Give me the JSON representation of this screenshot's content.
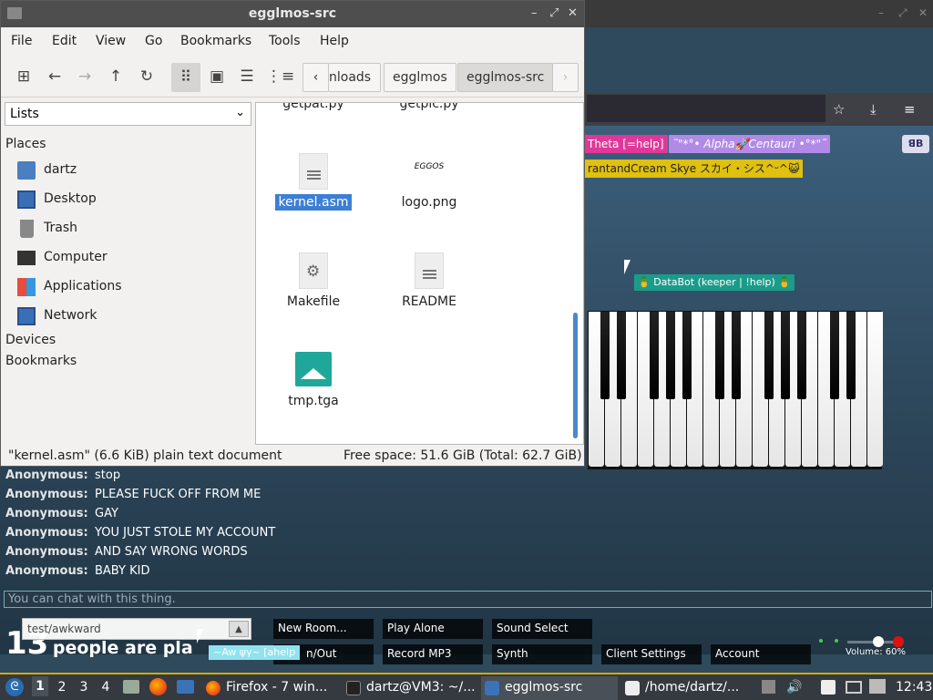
{
  "file_manager": {
    "title": "egglmos-src",
    "menu": [
      "File",
      "Edit",
      "View",
      "Go",
      "Bookmarks",
      "Tools",
      "Help"
    ],
    "path": [
      "nloads",
      "egglmos",
      "egglmos-src"
    ],
    "side_combo": "Lists",
    "places_label": "Places",
    "places": [
      {
        "label": "dartz",
        "icon": "home-folder-icon"
      },
      {
        "label": "Desktop",
        "icon": "desktop-icon"
      },
      {
        "label": "Trash",
        "icon": "trash-icon"
      },
      {
        "label": "Computer",
        "icon": "computer-icon"
      },
      {
        "label": "Applications",
        "icon": "applications-icon"
      },
      {
        "label": "Network",
        "icon": "network-icon"
      }
    ],
    "devices_label": "Devices",
    "bookmarks_label": "Bookmarks",
    "files": [
      {
        "name": "getpat.py",
        "type": "text",
        "partial": true
      },
      {
        "name": "getpic.py",
        "type": "text",
        "partial": true
      },
      {
        "name": "kernel.asm",
        "type": "text",
        "selected": true
      },
      {
        "name": "logo.png",
        "type": "image-logo",
        "logo_text": "EGGOS"
      },
      {
        "name": "Makefile",
        "type": "makefile"
      },
      {
        "name": "README",
        "type": "text"
      },
      {
        "name": "tmp.tga",
        "type": "image"
      }
    ],
    "status_left": "\"kernel.asm\" (6.6 KiB) plain text document",
    "status_right": "Free space: 51.6 GiB (Total: 62.7 GiB)"
  },
  "piano_page": {
    "nametags": [
      {
        "text": "Theta [=help]",
        "color": "#e0389a"
      },
      {
        "text": "˜\"*°• Alpha🚀Centauri •°*\"˜",
        "color": "#b18ae8"
      },
      {
        "text": "rantandCream Skye スカイ・シス^ᵕ^😺",
        "color": "#e0c010"
      },
      {
        "text": "🍍 DataBot (keeper | !help) 🍍",
        "color": "#1b9c8a"
      }
    ],
    "chat": [
      {
        "who": "Anonymous:",
        "msg": "stop"
      },
      {
        "who": "Anonymous:",
        "msg": "PLEASE FUCK OFF FROM ME"
      },
      {
        "who": "Anonymous:",
        "msg": "GAY"
      },
      {
        "who": "Anonymous:",
        "msg": "YOU JUST STOLE MY ACCOUNT"
      },
      {
        "who": "Anonymous:",
        "msg": "AND SAY WRONG WORDS"
      },
      {
        "who": "Anonymous:",
        "msg": "BABY KID"
      }
    ],
    "chat_placeholder": "You can chat with this thing.",
    "room": "test/awkward",
    "player_count": "13",
    "player_count_text": "people are pla",
    "buttons_row1": [
      "New Room...",
      "Play Alone",
      "Sound Select"
    ],
    "buttons_row2": [
      "n/Out",
      "Record MP3",
      "Synth",
      "Client Settings",
      "Account"
    ],
    "volume": "Volume: 60%",
    "volume_level": 0.6,
    "tooltip_text": "~Aw ψγ~ [ahelp"
  },
  "taskbar": {
    "workspaces": [
      "1",
      "2",
      "3",
      "4"
    ],
    "tasks": [
      {
        "label": "Firefox - 7 win...",
        "icon": "firefox-icon",
        "active": false
      },
      {
        "label": "dartz@VM3: ~/...",
        "icon": "terminal-icon",
        "active": false
      },
      {
        "label": "egglmos-src",
        "icon": "folder-icon",
        "active": true
      },
      {
        "label": "/home/dartz/...",
        "icon": "editor-icon",
        "active": false
      }
    ],
    "clock": "12:43"
  }
}
